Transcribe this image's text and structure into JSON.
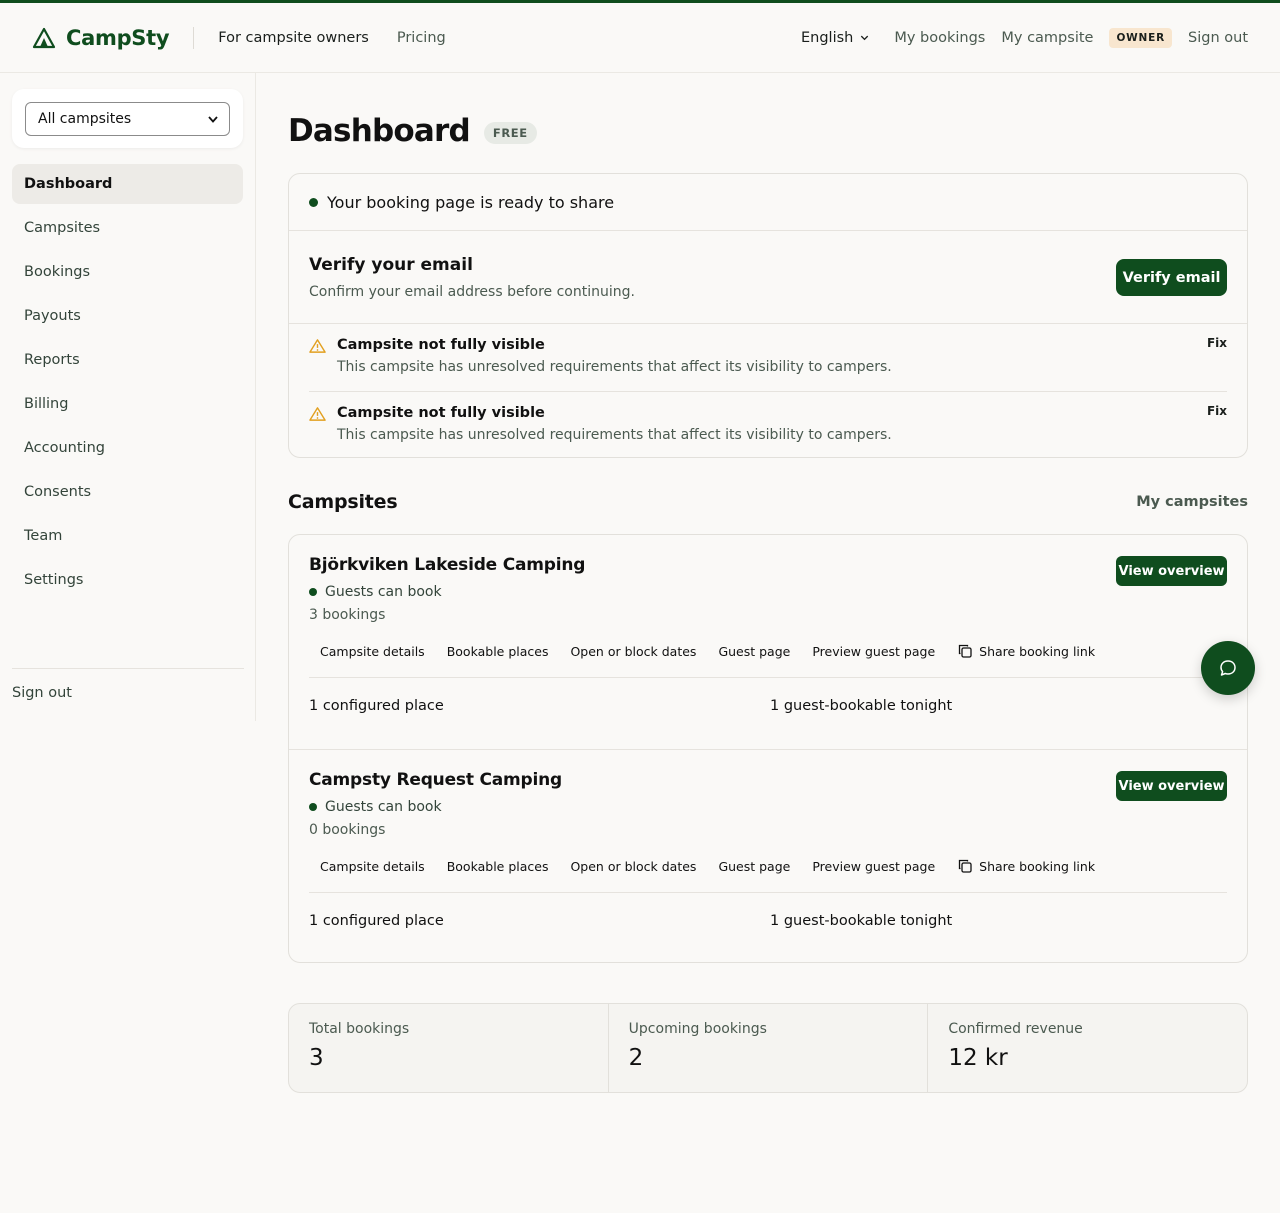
{
  "colors": {
    "brand": "#0f4d1e",
    "warning": "#e2a020",
    "owner_badge_bg": "#f8e6cf"
  },
  "header": {
    "brand": "CampSty",
    "logo_icon": "tent-icon",
    "nav": {
      "owners": "For campsite owners",
      "pricing": "Pricing"
    },
    "language": "English",
    "my_bookings": "My bookings",
    "my_campsite": "My campsite",
    "role_badge": "OWNER",
    "sign_out": "Sign out"
  },
  "sidebar": {
    "campsite_select": "All campsites",
    "items": [
      {
        "label": "Dashboard",
        "active": true
      },
      {
        "label": "Campsites"
      },
      {
        "label": "Bookings"
      },
      {
        "label": "Payouts"
      },
      {
        "label": "Reports"
      },
      {
        "label": "Billing"
      },
      {
        "label": "Accounting"
      },
      {
        "label": "Consents"
      },
      {
        "label": "Team"
      },
      {
        "label": "Settings"
      }
    ],
    "sign_out": "Sign out"
  },
  "page": {
    "title": "Dashboard",
    "plan_badge": "FREE"
  },
  "alerts": {
    "ready": "Your booking page is ready to share",
    "verify": {
      "title": "Verify your email",
      "description": "Confirm your email address before continuing.",
      "button": "Verify email"
    },
    "warnings": [
      {
        "title": "Campsite not fully visible",
        "description": "This campsite has unresolved requirements that affect its visibility to campers.",
        "action": "Fix"
      },
      {
        "title": "Campsite not fully visible",
        "description": "This campsite has unresolved requirements that affect its visibility to campers.",
        "action": "Fix"
      }
    ]
  },
  "campsites_section": {
    "title": "Campsites",
    "link": "My campsites",
    "items": [
      {
        "name": "Björkviken Lakeside Camping",
        "status": "Guests can book",
        "bookings": "3 bookings",
        "view_button": "View overview",
        "actions": [
          "Campsite details",
          "Bookable places",
          "Open or block dates",
          "Guest page",
          "Preview guest page",
          "Share booking link"
        ],
        "configured": "1 configured place",
        "tonight": "1 guest-bookable tonight"
      },
      {
        "name": "Campsty Request Camping",
        "status": "Guests can book",
        "bookings": "0 bookings",
        "view_button": "View overview",
        "actions": [
          "Campsite details",
          "Bookable places",
          "Open or block dates",
          "Guest page",
          "Preview guest page",
          "Share booking link"
        ],
        "configured": "1 configured place",
        "tonight": "1 guest-bookable tonight"
      }
    ]
  },
  "stats": [
    {
      "label": "Total bookings",
      "value": "3"
    },
    {
      "label": "Upcoming bookings",
      "value": "2"
    },
    {
      "label": "Confirmed revenue",
      "value": "12 kr"
    }
  ]
}
